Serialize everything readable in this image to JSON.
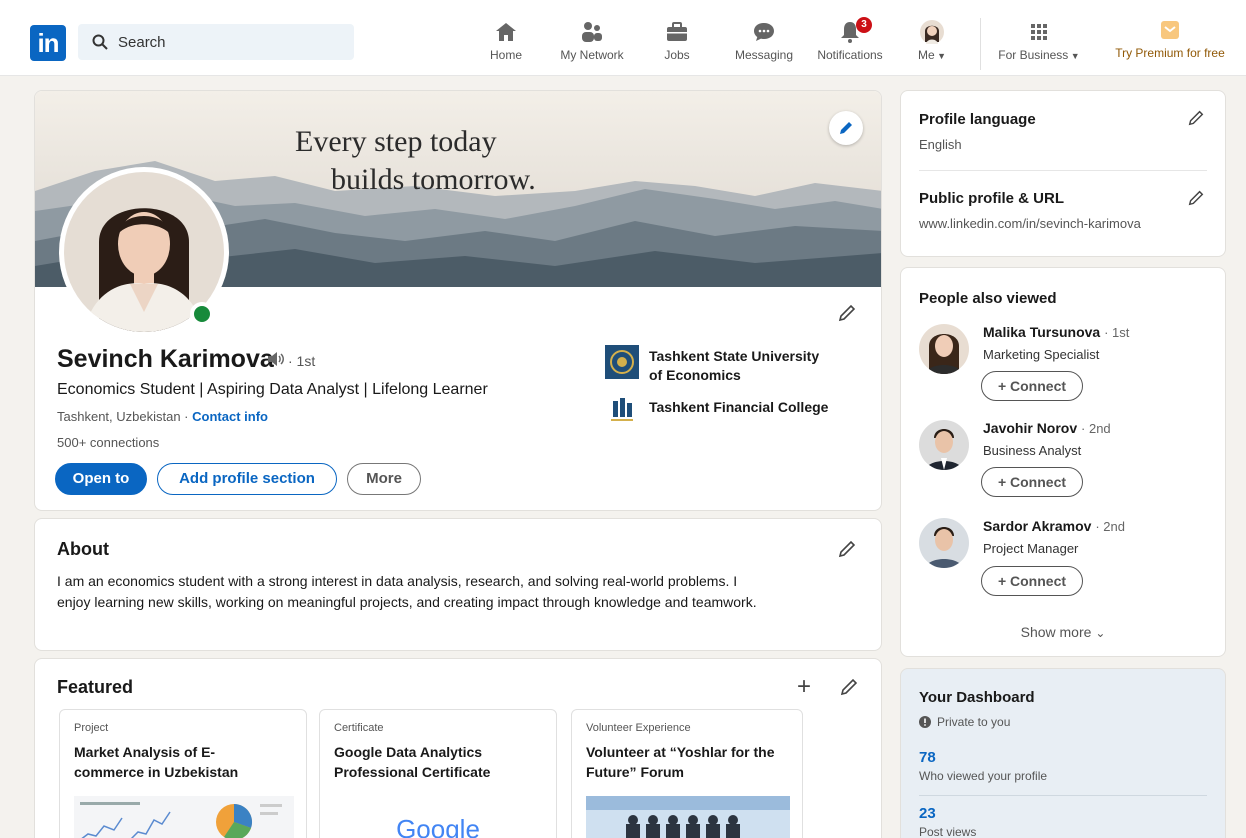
{
  "nav": {
    "logo": "in",
    "search_placeholder": "Search",
    "items": [
      {
        "label": "Home",
        "icon": "home-icon"
      },
      {
        "label": "My Network",
        "icon": "people-icon"
      },
      {
        "label": "Jobs",
        "icon": "briefcase-icon"
      },
      {
        "label": "Messaging",
        "icon": "chat-icon"
      },
      {
        "label": "Notifications",
        "icon": "bell-icon",
        "badge": "3"
      },
      {
        "label": "Me",
        "icon": "avatar"
      },
      {
        "label": "For Business",
        "icon": "grid-icon"
      }
    ],
    "premium_label": "Try Premium for free"
  },
  "profile": {
    "banner_quote_line1": "Every step today",
    "banner_quote_line2": "builds tomorrow.",
    "name": "Sevinch Karimova",
    "degree": "· 1st",
    "headline": "Economics Student | Aspiring Data Analyst | Lifelong Learner",
    "location": "Tashkent, Uzbekistan ·",
    "contact_info": "Contact info",
    "connections": "500+ connections",
    "buttons": {
      "open_to": "Open to",
      "add_section": "Add profile section",
      "more": "More"
    },
    "education": [
      {
        "line1": "Tashkent State University",
        "line2": "of Economics"
      },
      {
        "line1": "Tashkent Financial College",
        "line2": ""
      }
    ],
    "status": "online"
  },
  "about": {
    "title": "About",
    "text": "I am an economics student with a strong interest in data analysis, research, and solving real-world problems. I enjoy learning new skills, working on meaningful projects, and creating impact through knowledge and teamwork."
  },
  "featured": {
    "title": "Featured",
    "items": [
      {
        "kind": "Project",
        "title": "Market Analysis of E-commerce in Uzbekistan"
      },
      {
        "kind": "Certificate",
        "title": "Google Data Analytics Professional Certificate",
        "thumb_text": "Google"
      },
      {
        "kind": "Volunteer Experience",
        "title": "Volunteer at “Yoshlar for the Future” Forum"
      }
    ]
  },
  "sidebar": {
    "language_title": "Profile language",
    "language_value": "English",
    "url_title": "Public profile & URL",
    "url_value": "www.linkedin.com/in/sevinch-karimova",
    "pav_title": "People also viewed",
    "people": [
      {
        "name": "Malika Tursunova",
        "degree": "· 1st",
        "role": "Marketing Specialist",
        "action": "+ Connect"
      },
      {
        "name": "Javohir Norov",
        "degree": "· 2nd",
        "role": "Business Analyst",
        "action": "+ Connect"
      },
      {
        "name": "Sardor Akramov",
        "degree": "· 2nd",
        "role": "Project Manager",
        "action": "+ Connect"
      }
    ],
    "show_more": "Show more",
    "dashboard": {
      "title": "Your Dashboard",
      "private": "Private to you",
      "stats": [
        {
          "value": "78",
          "label": "Who viewed your profile"
        },
        {
          "value": "23",
          "label": "Post views"
        }
      ]
    }
  },
  "colors": {
    "brand": "#0a66c2",
    "online": "#178a3b",
    "badge": "#cc1016",
    "premium": "#915907"
  }
}
